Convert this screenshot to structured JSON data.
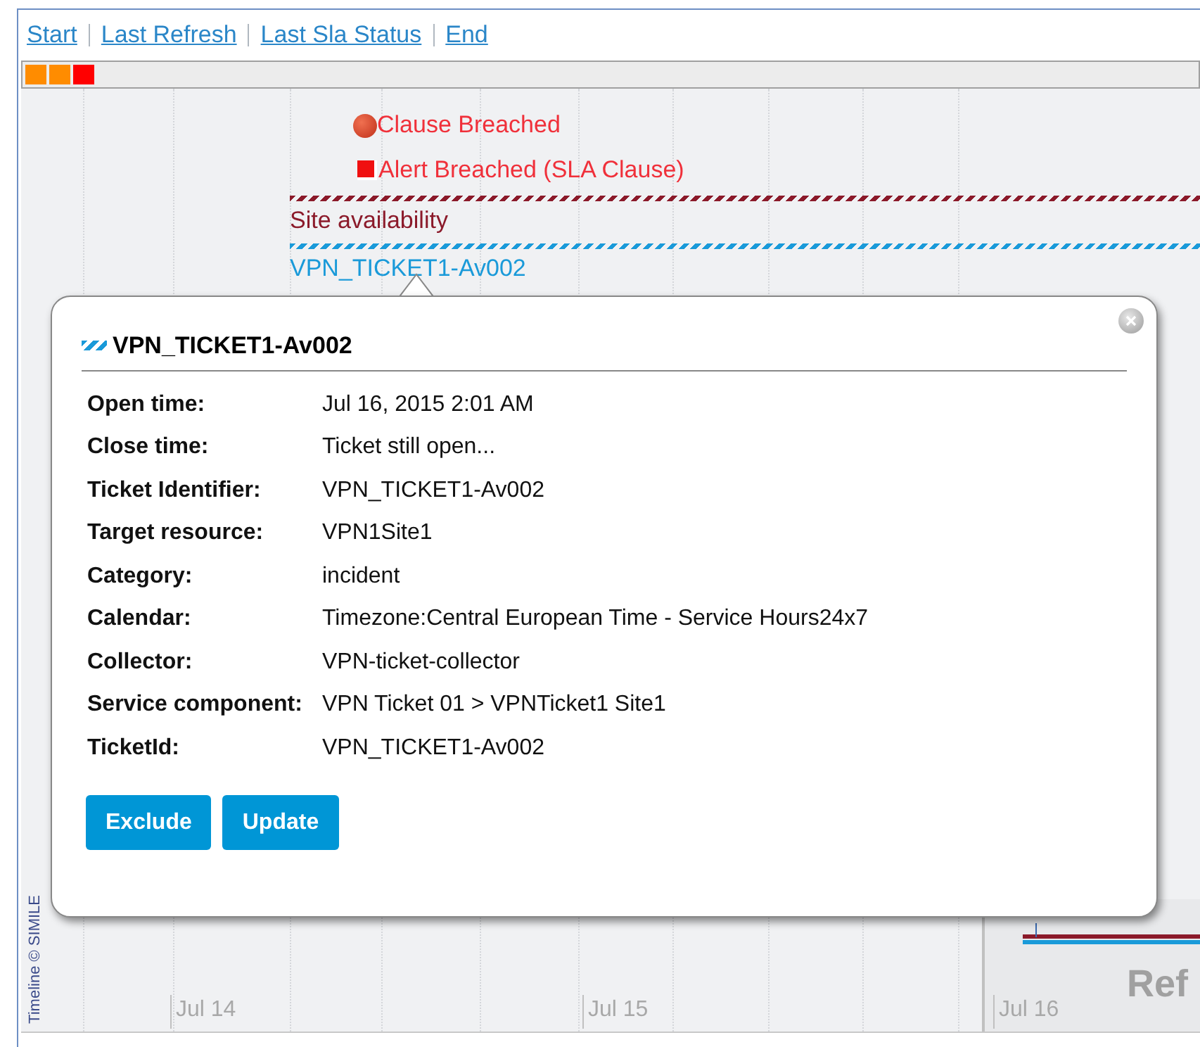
{
  "nav_links": [
    "Start",
    "Last Refresh",
    "Last Sla Status",
    "End"
  ],
  "overview_markers": [
    {
      "color": "#ff8c00"
    },
    {
      "color": "#ff8c00"
    },
    {
      "color": "#ff0000"
    }
  ],
  "events": [
    {
      "kind": "clause",
      "label": "Clause Breached"
    },
    {
      "kind": "alert",
      "label": "Alert Breached (SLA Clause)"
    },
    {
      "kind": "band",
      "label": "Site availability",
      "color": "#8b1a2a"
    },
    {
      "kind": "band",
      "label": "VPN_TICKET1-Av002",
      "color": "#1a9ad9"
    }
  ],
  "popup": {
    "title": "VPN_TICKET1-Av002",
    "fields": [
      {
        "label": "Open time:",
        "value": "Jul 16, 2015 2:01 AM"
      },
      {
        "label": "Close time:",
        "value": "Ticket still open..."
      },
      {
        "label": "Ticket Identifier:",
        "value": "VPN_TICKET1-Av002"
      },
      {
        "label": "Target resource:",
        "value": "VPN1Site1"
      },
      {
        "label": "Category:",
        "value": "incident"
      },
      {
        "label": "Calendar:",
        "value": "Timezone:Central European Time - Service Hours24x7"
      },
      {
        "label": "Collector:",
        "value": "VPN-ticket-collector"
      },
      {
        "label": "Service component:",
        "value": "VPN Ticket 01 > VPNTicket1 Site1"
      },
      {
        "label": "TicketId:",
        "value": "VPN_TICKET1-Av002"
      }
    ],
    "buttons": [
      "Exclude",
      "Update"
    ]
  },
  "axis_labels": [
    "Jul 14",
    "Jul 15",
    "Jul 16"
  ],
  "overview_band_label": "Ref",
  "credit": "Timeline © SIMILE"
}
